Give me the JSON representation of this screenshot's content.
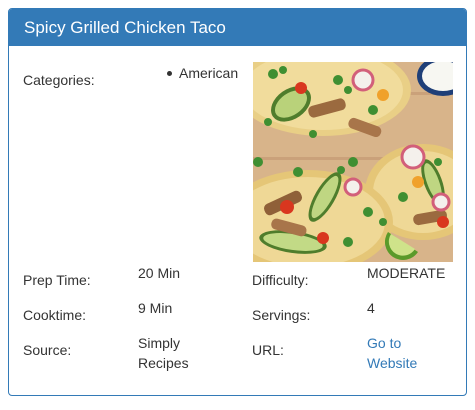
{
  "card": {
    "title": "Spicy Grilled Chicken Taco"
  },
  "categories": {
    "label": "Categories:",
    "items": [
      "American"
    ]
  },
  "prep_time": {
    "label": "Prep Time:",
    "value": "20 Min"
  },
  "difficulty": {
    "label": "Difficulty:",
    "value": "MODERATE"
  },
  "cooktime": {
    "label": "Cooktime:",
    "value": "9 Min"
  },
  "servings": {
    "label": "Servings:",
    "value": "4"
  },
  "source": {
    "label": "Source:",
    "value_line1": "Simply",
    "value_line2": "Recipes"
  },
  "url": {
    "label": "URL:",
    "link_line1": "Go to",
    "link_line2": "Website"
  },
  "colors": {
    "header_bg": "#337ab7",
    "link": "#337ab7",
    "text": "#333333"
  },
  "image": {
    "subject": "grilled-chicken-tacos-photo"
  }
}
